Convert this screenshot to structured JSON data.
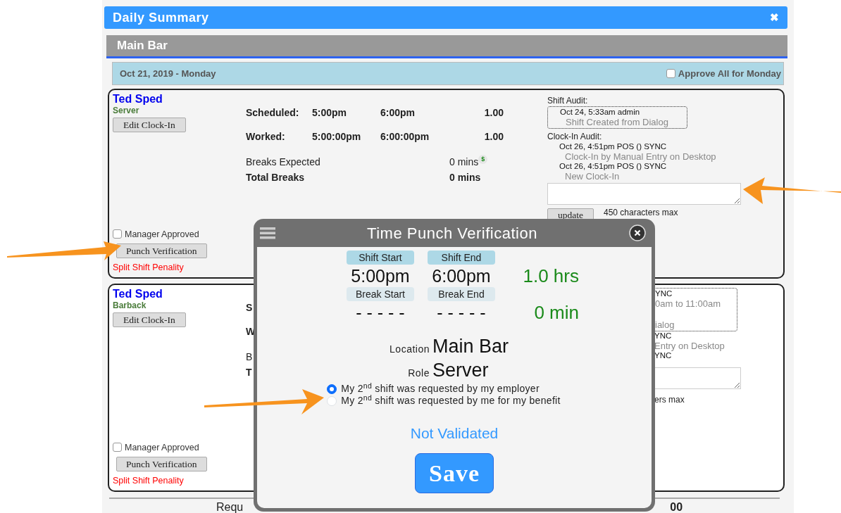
{
  "window": {
    "title": "Daily Summary",
    "close_label": "✖"
  },
  "section": {
    "title": "Main Bar"
  },
  "day": {
    "date": "Oct 21, 2019 - Monday",
    "approve_all": {
      "label": "Approve All for Monday",
      "checked": false
    }
  },
  "shifts": [
    {
      "kind": "full",
      "name": "Ted Sped",
      "role": "Server",
      "edit_button": "Edit Clock-In",
      "rows": [
        {
          "kind": "time",
          "label": "Scheduled:",
          "start": "5:00pm",
          "end": "6:00pm",
          "hours": "1.00"
        },
        {
          "kind": "time",
          "label": "Worked:",
          "start": "5:00:00pm",
          "end": "6:00:00pm",
          "hours": "1.00"
        },
        {
          "kind": "break",
          "label": "Breaks Expected",
          "value": "0 mins",
          "badge": "$"
        },
        {
          "kind": "total",
          "label": "Total Breaks",
          "value": "0 mins"
        }
      ],
      "shift_audit": {
        "label": "Shift Audit:",
        "lines": [
          {
            "kind": "header",
            "text": "Oct 24, 5:33am admin"
          },
          {
            "kind": "detail",
            "text": "Shift Created from Dialog"
          }
        ]
      },
      "clockin_audit": {
        "label": "Clock-In Audit:",
        "lines": [
          {
            "kind": "header",
            "text": "Oct 26, 4:51pm POS () SYNC"
          },
          {
            "kind": "detail",
            "text": "Clock-In by Manual Entry on Desktop"
          },
          {
            "kind": "header",
            "text": "Oct 26, 4:51pm POS () SYNC"
          },
          {
            "kind": "detail",
            "text": "New Clock-In"
          }
        ]
      },
      "update_button": "update",
      "char_limit": "450 characters max",
      "manager_approved": {
        "label": "Manager Approved",
        "checked": false
      },
      "verify_button": "Punch Verification",
      "penalty": "Split Shift Penality"
    },
    {
      "kind": "covered",
      "name": "Ted Sped",
      "role": "Barback",
      "edit_button": "Edit Clock-In",
      "rows": [
        {
          "kind": "time",
          "label": "S"
        },
        {
          "kind": "time",
          "label": "W"
        },
        {
          "kind": "break",
          "label": "B"
        },
        {
          "kind": "total",
          "label": "T"
        }
      ],
      "shift_audit": {
        "lines": [
          {
            "kind": "header",
            "text": "YNC"
          },
          {
            "kind": "detail",
            "text": "0am to 11:00am"
          },
          {
            "kind": "gap"
          },
          {
            "kind": "detail",
            "text": "ialog"
          }
        ]
      },
      "clockin_audit": {
        "lines": [
          {
            "kind": "header",
            "text": "YNC"
          },
          {
            "kind": "detail",
            "text": "Entry on Desktop"
          },
          {
            "kind": "header",
            "text": "YNC"
          }
        ]
      },
      "char_limit": "ers max",
      "manager_approved": {
        "label": "Manager Approved",
        "checked": false
      },
      "verify_button": "Punch Verification",
      "penalty": "Split Shift Penality"
    }
  ],
  "footer": {
    "label": "Requ",
    "value": "00"
  },
  "dialog": {
    "title": "Time Punch Verification",
    "times": [
      {
        "kind": "shift",
        "start_label": "Shift Start",
        "start": "5:00pm",
        "end_label": "Shift End",
        "end": "6:00pm",
        "total": "1.0 hrs"
      },
      {
        "kind": "break",
        "start_label": "Break Start",
        "start": "- - - - -",
        "end_label": "Break End",
        "end": "- - - - -",
        "total": "0 min"
      }
    ],
    "location": {
      "label": "Location",
      "value": "Main Bar"
    },
    "role": {
      "label": "Role",
      "value": "Server"
    },
    "options": [
      {
        "text": "My 2$^{nd}$ shift was requested by my employer",
        "selected": true
      },
      {
        "text": "My 2$^{nd}$ shift was requested by me for my benefit",
        "selected": false
      }
    ],
    "status": "Not Validated",
    "save_button": "Save"
  }
}
